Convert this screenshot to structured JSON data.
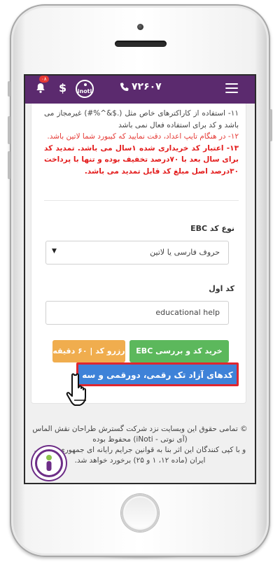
{
  "header": {
    "phone_number": "۷۲۶۰۷",
    "logo_text": "inoti",
    "currency_symbol": "$",
    "notification_count": "۰۸"
  },
  "rules": {
    "item11": "۱۱- استفاده از کاراکترهای خاص مثل (.$&^%#) غیرمجاز می باشد و کد برای استفاده فعال نمی باشد",
    "item12": "۱۲- در هنگام تایپ اعداد، دقت نمایید که کیبورد شما لاتین باشد.",
    "item13": "۱۳- اعتبار کد خریداری شده ۱سال می باشد. تمدید کد برای سال بعد با ۷۰درصد تخفیف بوده و تنها با پرداخت ۳۰درصد اصل مبلغ کد قابل تمدید می باشد."
  },
  "form": {
    "code_type_label": "نوع کد EBC",
    "code_type_value": "حروف فارسی یا لاتین",
    "first_code_label": "کد اول",
    "first_code_value": "educational help"
  },
  "buttons": {
    "buy_check": "خرید کد و بررسی EBC",
    "reserve": "رزرو کد | ۶۰ دقیقه",
    "free_codes": "کدهای آزاد تک رقمی، دورقمی و سه رقمی"
  },
  "footer": {
    "line1": "© تمامی حقوق این وبسایت نزد شرکت گسترش طراحان نقش الماس",
    "line2": "(آی نوتی - iNoti) محفوظ بوده",
    "line3": "و با کپی کنندگان این اثر بنا به قوانین جرایم رایانه ای جمهوری اسلامی",
    "line4": "ایران (ماده ۱۲، ۱ و ۲۵) برخورد خواهد شد."
  },
  "colors": {
    "header_bg": "#5b2a6e",
    "green_button": "#5cb85c",
    "orange_button": "#f0ad4e",
    "blue_button": "#3e82d8",
    "highlight_border": "#e0262e"
  }
}
